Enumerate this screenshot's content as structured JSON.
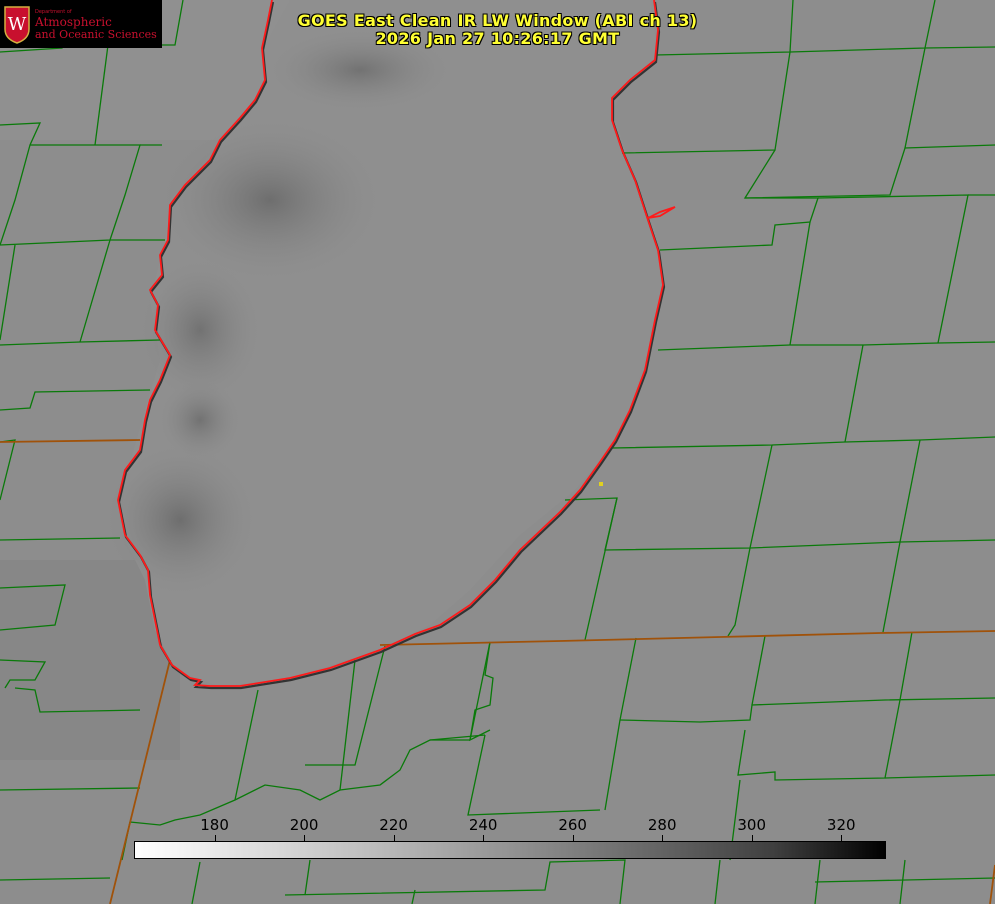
{
  "title_line1": "GOES East Clean IR LW Window (ABI ch 13)",
  "title_line2": "2026 Jan 27 10:26:17 GMT",
  "logo": {
    "dept": "Department of",
    "line1": "Atmospheric",
    "line2": "and Oceanic Sciences",
    "seal_letter": "W"
  },
  "colorbar": {
    "unit_range": [
      162,
      330
    ],
    "ticks": [
      "180",
      "200",
      "220",
      "240",
      "260",
      "280",
      "300",
      "320"
    ]
  },
  "colors": {
    "county_lines": "#0a7a0a",
    "state_lines": "#a0520a",
    "coastline": "#ff1a1a",
    "title": "#ffff33",
    "marker": "#e0d020"
  }
}
